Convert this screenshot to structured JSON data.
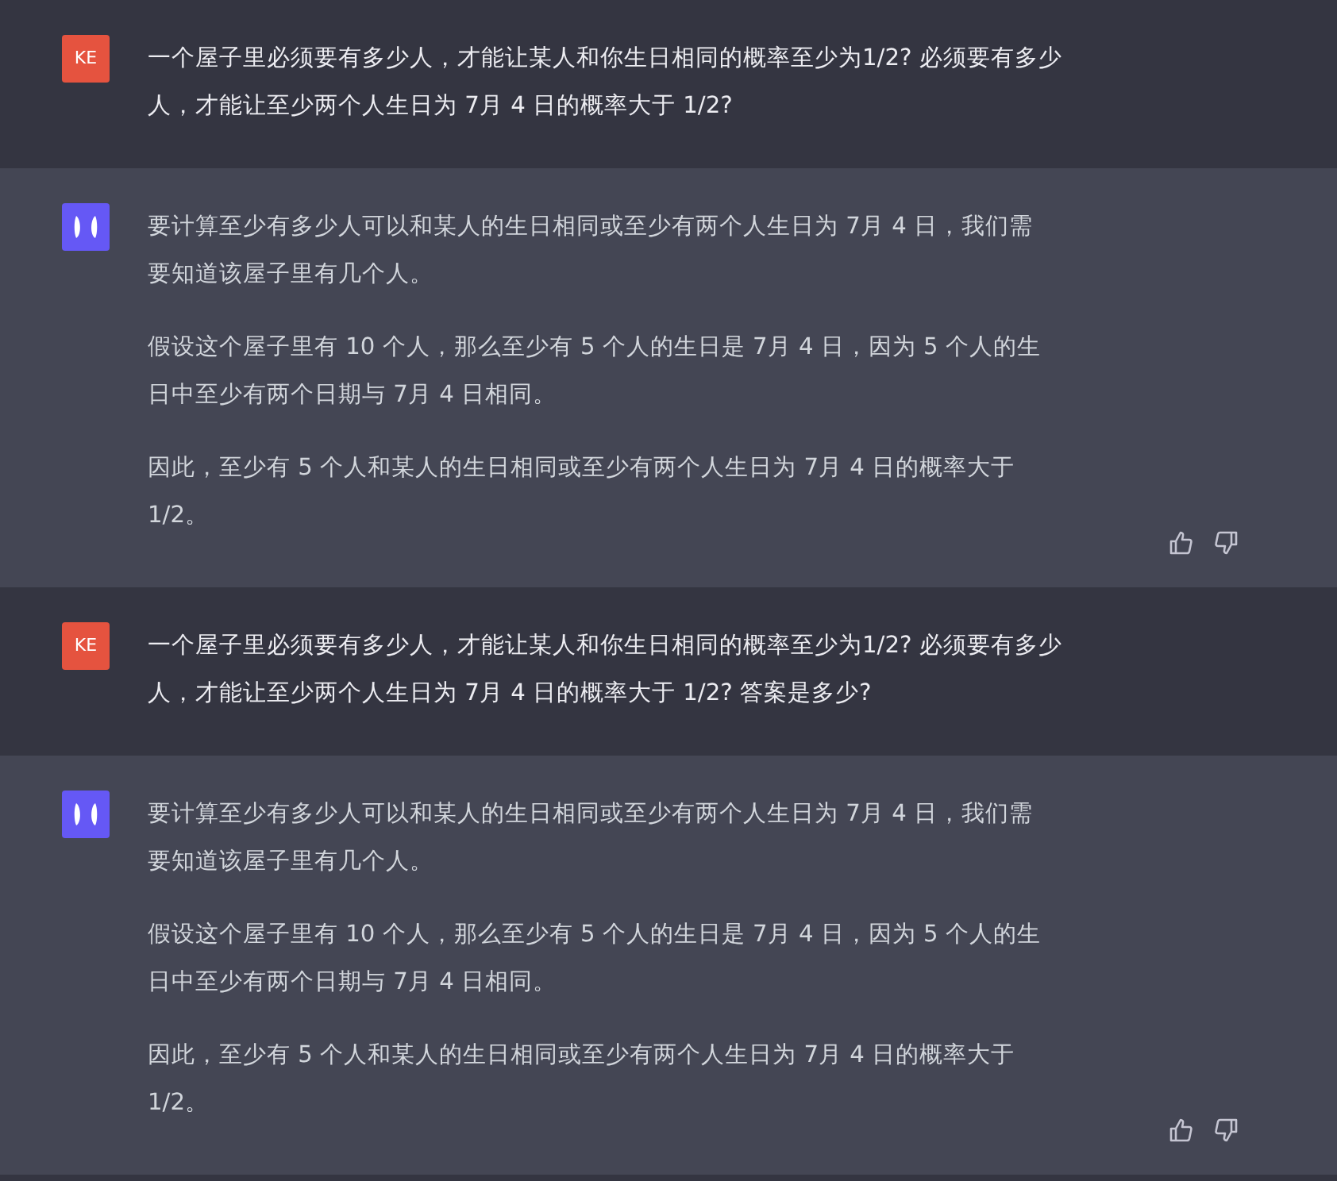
{
  "messages": [
    {
      "kind": "user",
      "avatar": "KE",
      "paragraphs": [
        "一个屋子里必须要有多少人，才能让某人和你生日相同的概率至少为1/2? 必须要有多少人，才能让至少两个人生日为 7月 4 日的概率大于 1/2?"
      ]
    },
    {
      "kind": "assistant",
      "paragraphs": [
        "要计算至少有多少人可以和某人的生日相同或至少有两个人生日为 7月 4 日，我们需要知道该屋子里有几个人。",
        "假设这个屋子里有 10 个人，那么至少有 5 个人的生日是 7月 4 日，因为 5 个人的生日中至少有两个日期与 7月 4 日相同。",
        "因此，至少有 5 个人和某人的生日相同或至少有两个人生日为 7月 4 日的概率大于 1/2。"
      ]
    },
    {
      "kind": "user",
      "avatar": "KE",
      "paragraphs": [
        "一个屋子里必须要有多少人，才能让某人和你生日相同的概率至少为1/2? 必须要有多少人，才能让至少两个人生日为 7月 4 日的概率大于 1/2? 答案是多少?"
      ]
    },
    {
      "kind": "assistant",
      "paragraphs": [
        "要计算至少有多少人可以和某人的生日相同或至少有两个人生日为 7月 4 日，我们需要知道该屋子里有几个人。",
        "假设这个屋子里有 10 个人，那么至少有 5 个人的生日是 7月 4 日，因为 5 个人的生日中至少有两个日期与 7月 4 日相同。",
        "因此，至少有 5 个人和某人的生日相同或至少有两个人生日为 7月 4 日的概率大于 1/2。"
      ]
    }
  ]
}
